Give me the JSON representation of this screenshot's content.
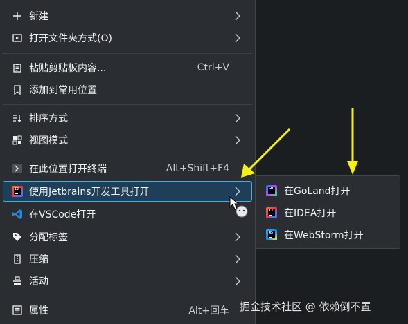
{
  "menu": {
    "items": [
      {
        "label": "新建",
        "icon": "plus-icon"
      },
      {
        "label": "打开文件夹方式(O)",
        "icon": "open-folder-icon"
      },
      {
        "label": "粘贴剪贴板内容...",
        "shortcut": "Ctrl+V",
        "icon": "clipboard-icon"
      },
      {
        "label": "添加到常用位置",
        "icon": "bookmark-icon"
      },
      {
        "label": "排序方式",
        "icon": "sort-icon"
      },
      {
        "label": "视图模式",
        "icon": "view-mode-icon"
      },
      {
        "label": "在此位置打开终端",
        "shortcut": "Alt+Shift+F4",
        "icon": "terminal-icon"
      },
      {
        "label": "使用Jetbrains开发工具打开",
        "icon": "jetbrains-icon"
      },
      {
        "label": "在VSCode打开",
        "icon": "vscode-icon"
      },
      {
        "label": "分配标签",
        "icon": "tag-icon"
      },
      {
        "label": "压缩",
        "icon": "compress-icon"
      },
      {
        "label": "活动",
        "icon": "activities-icon"
      },
      {
        "label": "属性",
        "shortcut": "Alt+回车",
        "icon": "properties-icon"
      }
    ]
  },
  "submenu": {
    "items": [
      {
        "label": "在GoLand打开",
        "icon": "goland-icon",
        "badge": "GO"
      },
      {
        "label": "在IDEA打开",
        "icon": "intellij-idea-icon",
        "badge": "IJ"
      },
      {
        "label": "在WebStorm打开",
        "icon": "webstorm-icon",
        "badge": "WS"
      }
    ]
  },
  "watermark": "掘金技术社区 @ 依赖倒不置",
  "colors": {
    "menu_bg": "#2a2e32",
    "highlight_bg": "#1f3e57",
    "highlight_border": "#3daee9",
    "annotation_arrow": "#f4f016"
  }
}
